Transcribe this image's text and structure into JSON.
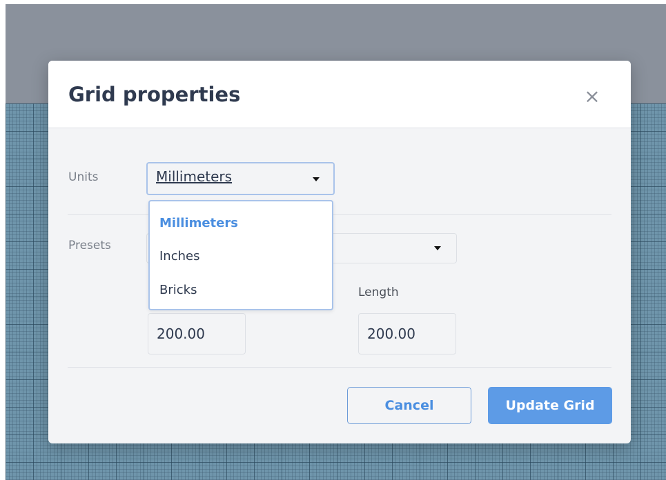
{
  "dialog": {
    "title": "Grid properties",
    "close_glyph": "×"
  },
  "units": {
    "label": "Units",
    "selected": "Millimeters",
    "options": [
      "Millimeters",
      "Inches",
      "Bricks"
    ]
  },
  "presets": {
    "label": "Presets"
  },
  "dimensions": {
    "width_value": "200.00",
    "length_label": "Length",
    "length_value": "200.00"
  },
  "buttons": {
    "cancel": "Cancel",
    "update": "Update Grid"
  },
  "icons": {
    "close": "close-icon",
    "caret": "caret-down-icon"
  },
  "colors": {
    "accent": "#5d9be6",
    "selected_option": "#4a8ee0",
    "focus_border": "#a9c3ea"
  }
}
